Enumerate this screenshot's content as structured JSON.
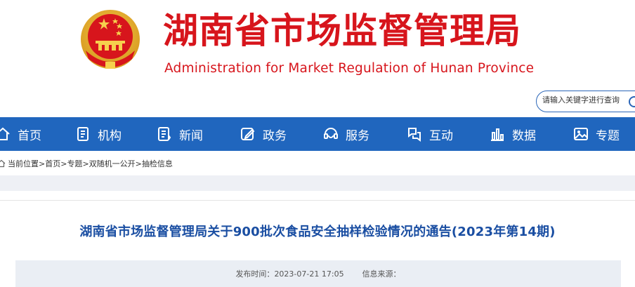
{
  "header": {
    "title_cn": "湖南省市场监督管理局",
    "title_en": "Administration for Market Regulation of Hunan Province"
  },
  "search": {
    "placeholder": "请输入关键字进行查询"
  },
  "nav": [
    {
      "label": "首页",
      "icon": "home-icon"
    },
    {
      "label": "机构",
      "icon": "org-icon"
    },
    {
      "label": "新闻",
      "icon": "news-icon"
    },
    {
      "label": "政务",
      "icon": "edit-icon"
    },
    {
      "label": "服务",
      "icon": "service-icon"
    },
    {
      "label": "互动",
      "icon": "interact-icon"
    },
    {
      "label": "数据",
      "icon": "bar-chart-icon"
    },
    {
      "label": "专题",
      "icon": "image-icon"
    }
  ],
  "breadcrumb": {
    "label": "当前位置",
    "sep_main": " > ",
    "items": [
      "首页",
      "专题",
      "双随机一公开",
      "抽检信息"
    ],
    "sep": ">"
  },
  "article": {
    "title": "湖南省市场监督管理局关于900批次食品安全抽样检验情况的通告(2023年第14期)",
    "publish_label": "发布时间：",
    "publish_time": "2023-07-21 17:05",
    "source_label": "信息来源："
  },
  "colors": {
    "brand_red": "#d7151c",
    "nav_blue": "#2066be",
    "title_blue": "#1a4ea2"
  }
}
